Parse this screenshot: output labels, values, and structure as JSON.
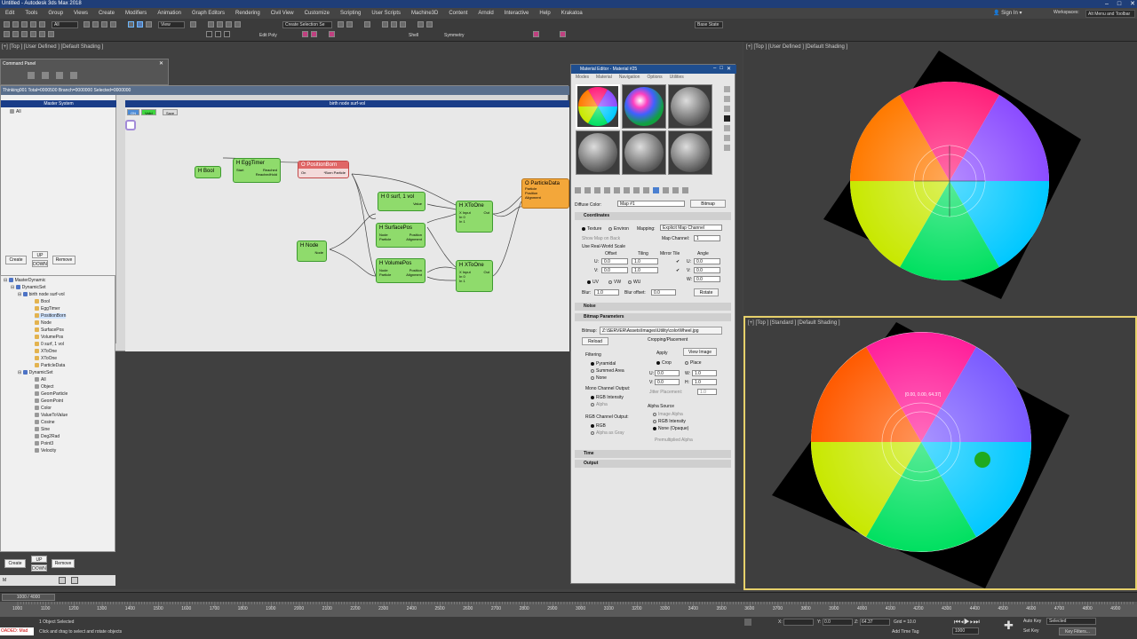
{
  "window": {
    "title": "Untitled - Autodesk 3ds Max 2018"
  },
  "menu": [
    "Edit",
    "Tools",
    "Group",
    "Views",
    "Create",
    "Modifiers",
    "Animation",
    "Graph Editors",
    "Rendering",
    "Civil View",
    "Customize",
    "Scripting",
    "User Scripts",
    "Machine3D",
    "Content",
    "Arnold",
    "Interactive",
    "Help",
    "Krakatoa"
  ],
  "account": {
    "signin": "Sign In",
    "workspace_label": "Workspaces:",
    "workspace_value": "Alt Menu and Toolbar"
  },
  "toolbar": {
    "filter": "All",
    "view": "View",
    "selection_set": "Create Selection Se",
    "base_state": "Base State",
    "edit_poly": "Edit Poly",
    "shell": "Shell",
    "symmetry": "Symmetry"
  },
  "viewports": {
    "left_label": "[+] [Top ] [User Defined ] [Default Shading ]",
    "top_right_label": "[+] [Top ] [User Defined ] [Default Shading ]",
    "bottom_right_label": "[+] [Top ] [Standard ] [Default Shading ]",
    "uv_readout": "[0.00, 0.00, 64.37]"
  },
  "command_panel": {
    "title": "Command Panel"
  },
  "thinking": {
    "header": "Thinking001  Total=0000500  Branch=0000000  Selected=0000000",
    "master_header": "Master System",
    "master_root": "All",
    "graph_header": "birth node surf-vol",
    "graph_buttons": [
      "ON",
      "Valid",
      "Save"
    ],
    "nodes": {
      "bool": "H Bool",
      "eggtimer": "H EggTimer",
      "eggtimer_ports": [
        "Start",
        "Reached",
        "ReachedHold"
      ],
      "positionborn": "O PositionBorn",
      "positionborn_ports": [
        "On",
        "*Born Particle"
      ],
      "particledata": "O ParticleData",
      "particledata_ports": [
        "Particle",
        "Position",
        "Alignment"
      ],
      "surfvol": "H 0 surf, 1 vol",
      "surfvol_port": "Value",
      "surfacepos": "H SurfacePos",
      "surfacepos_ports": [
        "Node",
        "Position",
        "Particle",
        "Alignment"
      ],
      "volumepos": "H VolumePos",
      "volumepos_ports": [
        "Node",
        "Position",
        "Particle",
        "Alignment"
      ],
      "xtoone1": "H XToOne",
      "xtoone2": "H XToOne",
      "xtoone_ports": [
        "X Input",
        "Out",
        "In 0",
        "In 1"
      ],
      "node": "H Node",
      "node_port": "Node"
    },
    "buttons": {
      "create": "Create",
      "up": "UP",
      "down": "DOWN",
      "remove": "Remove"
    },
    "tree": [
      "MasterDynamic",
      "DynamicSet",
      "birth node surf-vol",
      "Bool",
      "EggTimer",
      "PositionBorn",
      "Node",
      "SurfacePos",
      "VolumePos",
      "0 surf, 1 vol",
      "XToOne",
      "XToOne",
      "ParticleData",
      "DynamicSet",
      "All",
      "Object",
      "GeomParticle",
      "GeomPoint",
      "Color",
      "ValueToValue",
      "Cosine",
      "Sine",
      "Deg2Rad",
      "Point3",
      "Velocity"
    ],
    "tree_buttons": {
      "create": "Create",
      "up": "UP",
      "down": "DOWN",
      "remove": "Remove",
      "mode": "M"
    }
  },
  "material_editor": {
    "title": "Material Editor - Material #25",
    "menu": [
      "Modes",
      "Material",
      "Navigation",
      "Options",
      "Utilities"
    ],
    "diffuse_label": "Diffuse Color:",
    "map_name": "Map #1",
    "map_type": "Bitmap",
    "coordinates": {
      "title": "Coordinates",
      "texture": "Texture",
      "environ": "Environ",
      "mapping_label": "Mapping:",
      "mapping": "Explicit Map Channel",
      "show_map_on_back": "Show Map on Back",
      "map_channel_label": "Map Channel:",
      "map_channel": "1",
      "real_world": "Use Real-World Scale",
      "col_offset": "Offset",
      "col_tiling": "Tiling",
      "col_mirror": "Mirror Tile",
      "col_angle": "Angle",
      "u": "U:",
      "v": "V:",
      "w": "W:",
      "u_offset": "0.0",
      "v_offset": "0.0",
      "u_tiling": "1.0",
      "v_tiling": "1.0",
      "u_angle": "0.0",
      "v_angle": "0.0",
      "w_angle": "0.0",
      "uv": "UV",
      "vw": "VW",
      "wu": "WU",
      "blur_label": "Blur:",
      "blur": "1.0",
      "blur_offset_label": "Blur offset:",
      "blur_offset": "0.0",
      "rotate": "Rotate"
    },
    "noise": "Noise",
    "bitmap_params": {
      "title": "Bitmap Parameters",
      "bitmap_label": "Bitmap:",
      "bitmap_path": "Z:\\SERVER\\Assets\\Images\\Utility\\colorWheel.jpg",
      "reload": "Reload",
      "cropping_title": "Cropping/Placement",
      "apply": "Apply",
      "view_image": "View Image",
      "crop": "Crop",
      "place": "Place",
      "u": "U:",
      "v": "V:",
      "w": "W:",
      "h": "H:",
      "u_val": "0.0",
      "v_val": "0.0",
      "w_val": "1.0",
      "h_val": "1.0",
      "jitter": "Jitter Placement:",
      "jitter_val": "1.0",
      "filtering_title": "Filtering",
      "pyramidal": "Pyramidal",
      "summed_area": "Summed Area",
      "none": "None",
      "mono_title": "Mono Channel Output:",
      "rgb_intensity": "RGB Intensity",
      "alpha": "Alpha",
      "rgb_title": "RGB Channel Output:",
      "rgb": "RGB",
      "alpha_as_gray": "Alpha as Gray",
      "alpha_source_title": "Alpha Source",
      "image_alpha": "Image Alpha",
      "rgb_intensity2": "RGB Intensity",
      "none_opaque": "None (Opaque)",
      "premult": "Premultiplied Alpha"
    },
    "time": "Time",
    "output": "Output"
  },
  "timeline": {
    "frame_counter": "1000 / 4000",
    "ticks": [
      "1000",
      "1100",
      "1200",
      "1300",
      "1400",
      "1500",
      "1600",
      "1700",
      "1800",
      "1900",
      "2000",
      "2100",
      "2200",
      "2300",
      "2400",
      "2500",
      "2600",
      "2700",
      "2800",
      "2900",
      "3000",
      "3100",
      "3200",
      "3300",
      "3400",
      "3500",
      "3600",
      "3700",
      "3800",
      "3900",
      "4000",
      "4100",
      "4200",
      "4300",
      "4400",
      "4500",
      "4600",
      "4700",
      "4800",
      "4900"
    ]
  },
  "status": {
    "script_listener": "OADED: Mad",
    "selected": "1 Object Selected",
    "prompt": "Click and drag to select and rotate objects",
    "x_label": "X:",
    "y_label": "Y:",
    "y_val": "0.0",
    "z_label": "Z:",
    "z_val": "64.37",
    "grid": "Grid = 10.0",
    "add_time_tag": "Add Time Tag",
    "auto_key": "Auto Key",
    "selected_dd": "Selected",
    "set_key": "Set Key",
    "key_filters": "Key Filters...",
    "frame_field": "1000"
  },
  "colors": {
    "node_green": "#8fdb6c",
    "node_orange": "#f3a73a",
    "node_red": "#e06666",
    "active_border": "#e6d06a",
    "title_blue": "#1f3e78"
  }
}
